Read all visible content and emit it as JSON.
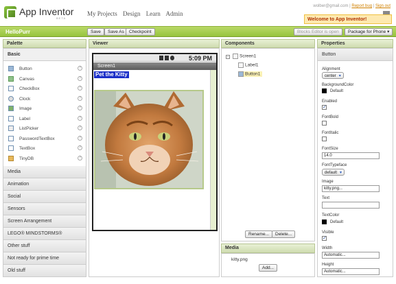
{
  "header": {
    "app_name": "App Inventor",
    "beta_label": "BETA",
    "nav": [
      "My Projects",
      "Design",
      "Learn",
      "Admin"
    ],
    "account_email": "wolber@gmail.com",
    "account_links": [
      "Report bug",
      "Sign out"
    ],
    "welcome_text": "Welcome to App Inventor!"
  },
  "projectbar": {
    "project_name": "HelloPurr",
    "save_label": "Save",
    "save_as_label": "Save As",
    "checkpoint_label": "Checkpoint",
    "blocks_editor_label": "Blocks Editor is open",
    "package_label": "Package for Phone"
  },
  "palette": {
    "header": "Palette",
    "open_section": "Basic",
    "items": [
      {
        "label": "Button",
        "icon": "button-icon"
      },
      {
        "label": "Canvas",
        "icon": "canvas-icon"
      },
      {
        "label": "CheckBox",
        "icon": "checkbox-icon"
      },
      {
        "label": "Clock",
        "icon": "clock-icon"
      },
      {
        "label": "Image",
        "icon": "image-icon"
      },
      {
        "label": "Label",
        "icon": "label-icon"
      },
      {
        "label": "ListPicker",
        "icon": "listpicker-icon"
      },
      {
        "label": "PasswordTextBox",
        "icon": "password-icon"
      },
      {
        "label": "TextBox",
        "icon": "textbox-icon"
      },
      {
        "label": "TinyDB",
        "icon": "tinydb-icon"
      }
    ],
    "help_glyph": "?",
    "sections": [
      "Media",
      "Animation",
      "Social",
      "Sensors",
      "Screen Arrangement",
      "LEGO® MINDSTORMS®",
      "Other stuff",
      "Not ready for prime time",
      "Old stuff"
    ]
  },
  "viewer": {
    "header": "Viewer",
    "time": "5:09 PM",
    "screen_title": "Screen1",
    "label_text": "Pet the Kitty"
  },
  "components": {
    "header": "Components",
    "toggle_glyph": "−",
    "tree": [
      {
        "label": "Screen1",
        "level": 0
      },
      {
        "label": "Label1",
        "level": 1
      },
      {
        "label": "Button1",
        "level": 1,
        "selected": true
      }
    ],
    "rename_label": "Rename...",
    "delete_label": "Delete..."
  },
  "media": {
    "header": "Media",
    "files": [
      "kitty.png"
    ],
    "add_label": "Add..."
  },
  "properties": {
    "header": "Properties",
    "component": "Button",
    "alignment_label": "Alignment",
    "alignment_value": "center",
    "bgcolor_label": "BackgroundColor",
    "bgcolor_value": "Default",
    "enabled_label": "Enabled",
    "enabled_checked": true,
    "fontbold_label": "FontBold",
    "fontbold_checked": false,
    "fontitalic_label": "FontItalic",
    "fontitalic_checked": false,
    "fontsize_label": "FontSize",
    "fontsize_value": "14.0",
    "fonttypeface_label": "FontTypeface",
    "fonttypeface_value": "default",
    "image_label": "Image",
    "image_value": "kitty.png...",
    "text_label": "Text",
    "text_value": "",
    "textcolor_label": "TextColor",
    "textcolor_value": "Default",
    "visible_label": "Visible",
    "visible_checked": true,
    "width_label": "Width",
    "width_value": "Automatic...",
    "height_label": "Height",
    "height_value": "Automatic..."
  },
  "colors": {
    "accent_green": "#97c43d",
    "label_blue": "#1b2fc8",
    "welcome_bg": "#fde9b0"
  }
}
